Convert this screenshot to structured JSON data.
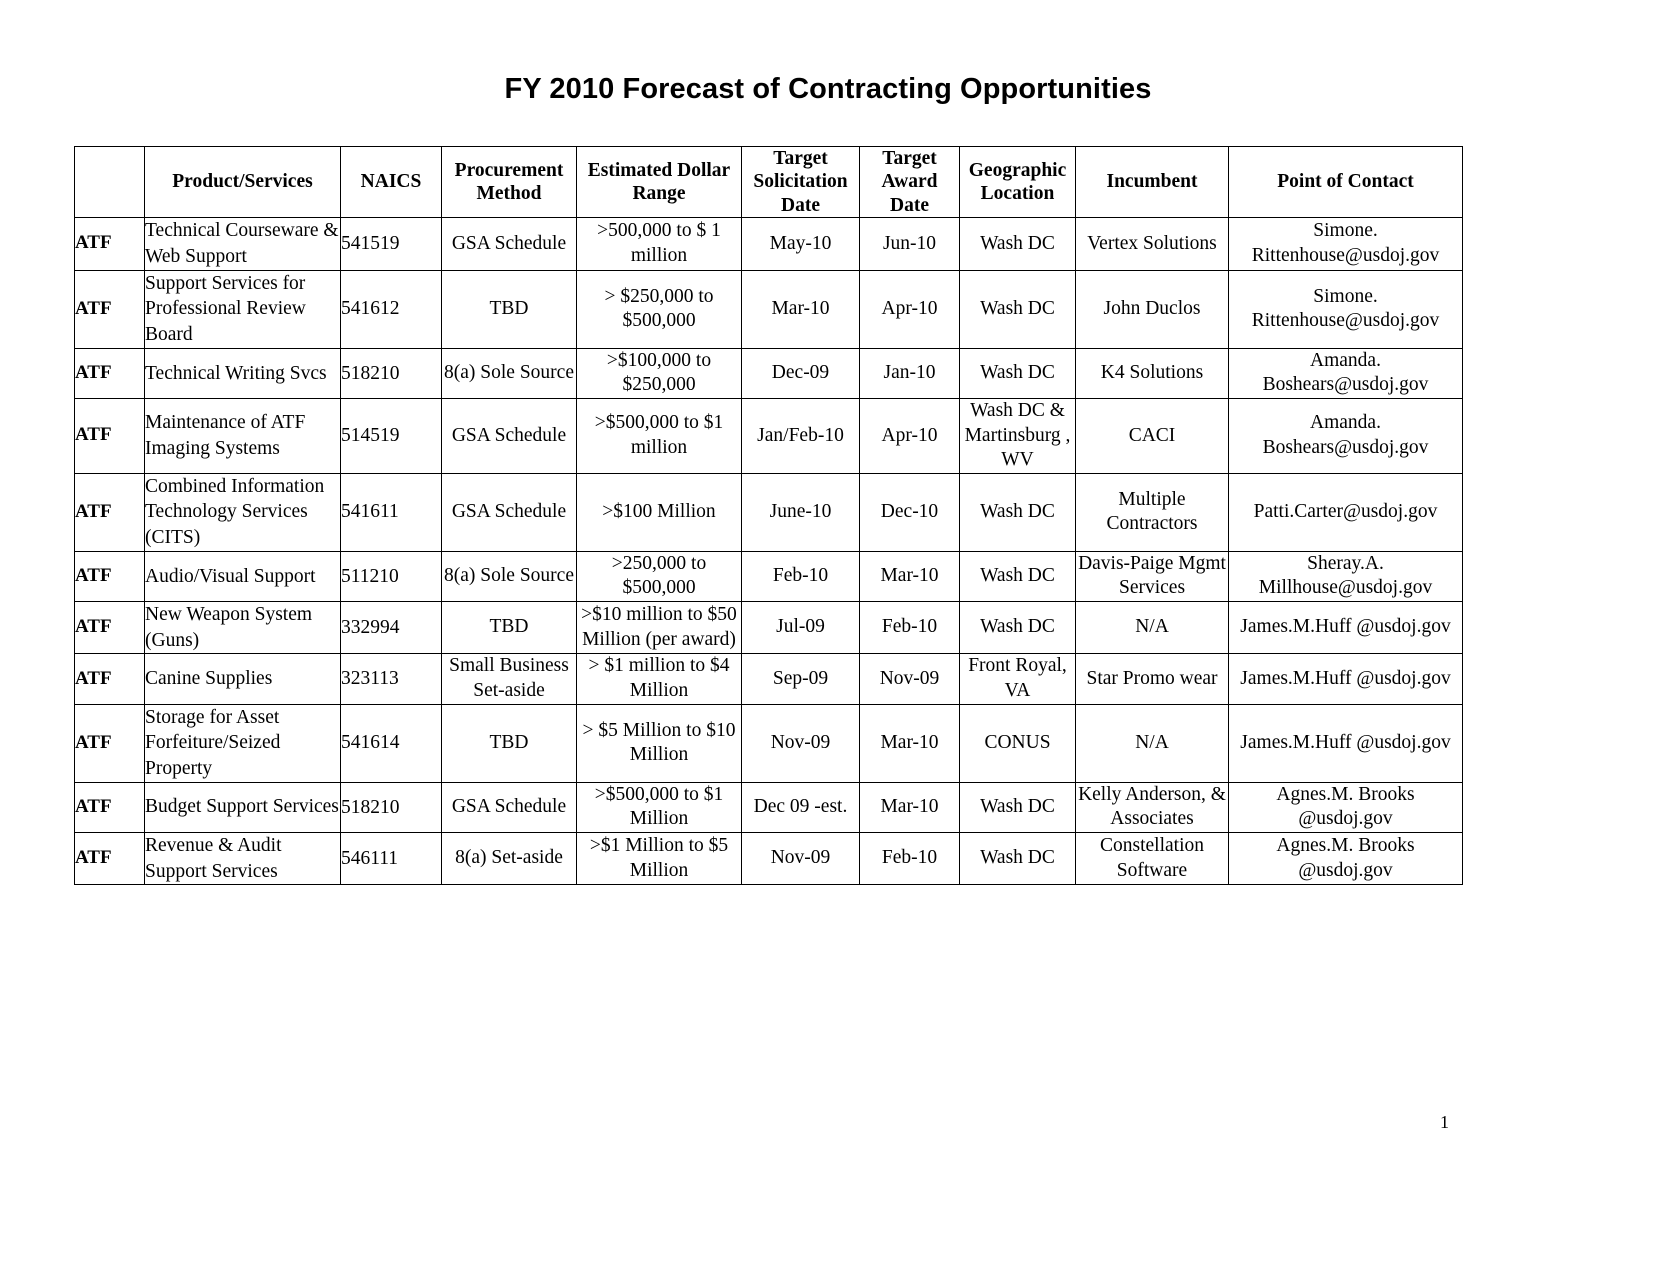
{
  "document": {
    "title": "FY 2010 Forecast of Contracting Opportunities",
    "page_number": "1"
  },
  "table": {
    "corner_header": "",
    "headers": [
      "Product/Services",
      "NAICS",
      "Procurement Method",
      "Estimated Dollar Range",
      "Target Solicitation Date",
      "Target Award Date",
      "Geographic Location",
      "Incumbent",
      "Point of Contact"
    ],
    "colors": {
      "header_fill": "#cccccc",
      "corner_fill": "#808080",
      "agency_fill": "#8ec5f5",
      "border": "#000000"
    },
    "rows": [
      {
        "agency": "ATF",
        "product": "Technical Courseware & Web Support",
        "naics": "541519",
        "method": "GSA Schedule",
        "dollar": ">500,000 to $ 1 million",
        "solicitation": "May-10",
        "award": "Jun-10",
        "location": "Wash DC",
        "incumbent": "Vertex Solutions",
        "contact": "Simone. Rittenhouse@usdoj.gov"
      },
      {
        "agency": "ATF",
        "product": "Support Services for Professional Review Board",
        "naics": "541612",
        "method": "TBD",
        "dollar": "> $250,000 to $500,000",
        "solicitation": "Mar-10",
        "award": "Apr-10",
        "location": "Wash DC",
        "incumbent": "John Duclos",
        "contact": "Simone. Rittenhouse@usdoj.gov"
      },
      {
        "agency": "ATF",
        "product": "Technical Writing Svcs",
        "naics": "518210",
        "method": "8(a) Sole Source",
        "dollar": ">$100,000 to $250,000",
        "solicitation": "Dec-09",
        "award": "Jan-10",
        "location": "Wash DC",
        "incumbent": "K4 Solutions",
        "contact": "Amanda. Boshears@usdoj.gov"
      },
      {
        "agency": "ATF",
        "product": "Maintenance of ATF Imaging Systems",
        "naics": "514519",
        "method": "GSA Schedule",
        "dollar": ">$500,000 to $1 million",
        "solicitation": "Jan/Feb-10",
        "award": "Apr-10",
        "location": "Wash DC & Martinsburg , WV",
        "incumbent": "CACI",
        "contact": "Amanda. Boshears@usdoj.gov"
      },
      {
        "agency": "ATF",
        "product": "Combined Information Technology Services (CITS)",
        "naics": "541611",
        "method": "GSA Schedule",
        "dollar": ">$100 Million",
        "solicitation": "June-10",
        "award": "Dec-10",
        "location": "Wash DC",
        "incumbent": "Multiple Contractors",
        "contact": "Patti.Carter@usdoj.gov"
      },
      {
        "agency": "ATF",
        "product": "Audio/Visual Support",
        "naics": "511210",
        "method": "8(a) Sole Source",
        "dollar": ">250,000 to $500,000",
        "solicitation": "Feb-10",
        "award": "Mar-10",
        "location": "Wash DC",
        "incumbent": "Davis-Paige Mgmt Services",
        "contact": "Sheray.A. Millhouse@usdoj.gov"
      },
      {
        "agency": "ATF",
        "product": "New Weapon System (Guns)",
        "naics": "332994",
        "method": "TBD",
        "dollar": ">$10 million to $50 Million (per award)",
        "solicitation": "Jul-09",
        "award": "Feb-10",
        "location": "Wash DC",
        "incumbent": "N/A",
        "contact": "James.M.Huff @usdoj.gov"
      },
      {
        "agency": "ATF",
        "product": "Canine Supplies",
        "naics": "323113",
        "method": "Small Business Set-aside",
        "dollar": "> $1 million to $4 Million",
        "solicitation": "Sep-09",
        "award": "Nov-09",
        "location": "Front Royal, VA",
        "incumbent": "Star Promo wear",
        "contact": "James.M.Huff @usdoj.gov"
      },
      {
        "agency": "ATF",
        "product": "Storage for Asset Forfeiture/Seized Property",
        "naics": "541614",
        "method": "TBD",
        "dollar": "> $5 Million to $10 Million",
        "solicitation": "Nov-09",
        "award": "Mar-10",
        "location": "CONUS",
        "incumbent": "N/A",
        "contact": "James.M.Huff @usdoj.gov"
      },
      {
        "agency": "ATF",
        "product": "Budget Support Services",
        "naics": "518210",
        "method": "GSA Schedule",
        "dollar": ">$500,000 to $1 Million",
        "solicitation": "Dec 09 -est.",
        "award": "Mar-10",
        "location": "Wash DC",
        "incumbent": "Kelly Anderson, & Associates",
        "contact": "Agnes.M. Brooks @usdoj.gov"
      },
      {
        "agency": "ATF",
        "product": "Revenue & Audit Support Services",
        "naics": "546111",
        "method": "8(a) Set-aside",
        "dollar": ">$1 Million to $5 Million",
        "solicitation": "Nov-09",
        "award": "Feb-10",
        "location": "Wash DC",
        "incumbent": "Constellation Software",
        "contact": "Agnes.M. Brooks @usdoj.gov"
      }
    ]
  }
}
